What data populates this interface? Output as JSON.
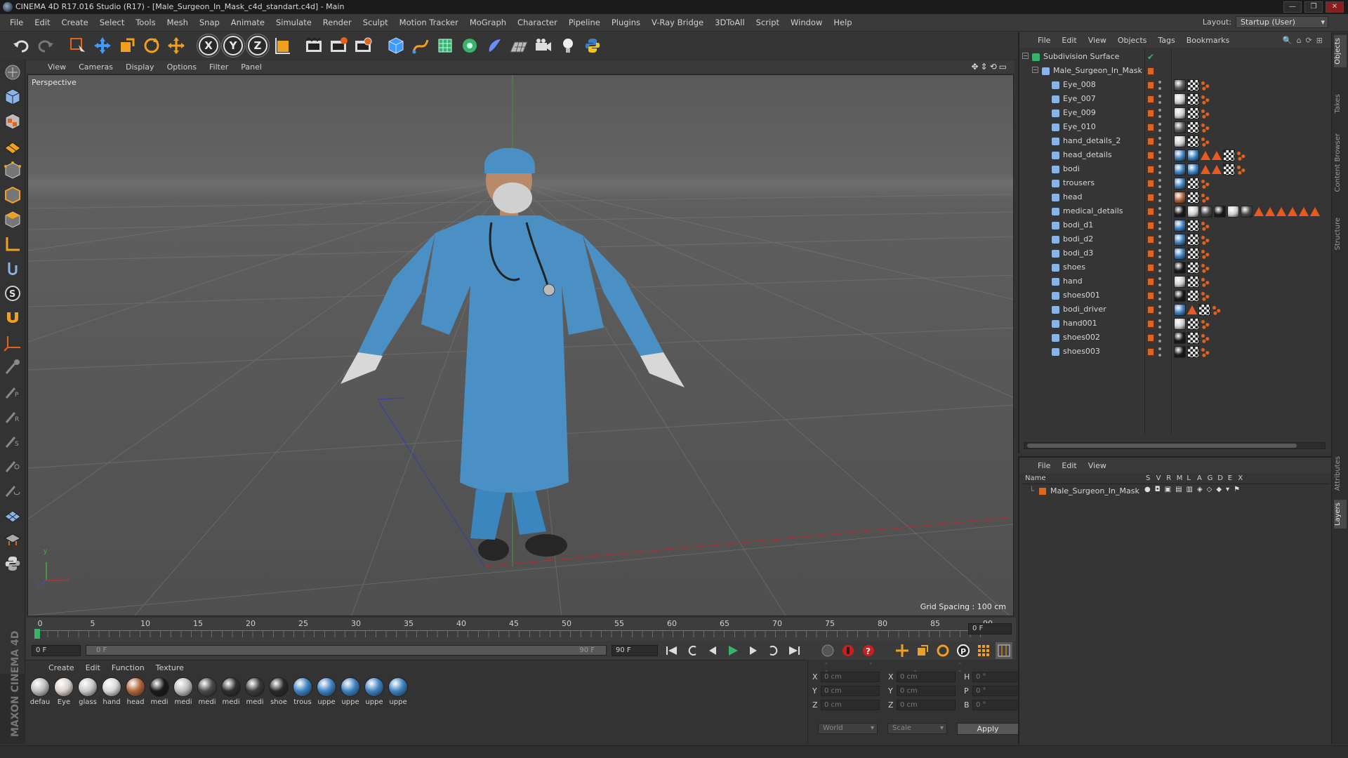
{
  "window": {
    "title": "CINEMA 4D R17.016 Studio (R17) - [Male_Surgeon_In_Mask_c4d_standart.c4d] - Main",
    "controls": [
      "—",
      "❐",
      "✕"
    ]
  },
  "menubar": {
    "items": [
      "File",
      "Edit",
      "Create",
      "Select",
      "Tools",
      "Mesh",
      "Snap",
      "Animate",
      "Simulate",
      "Render",
      "Sculpt",
      "Motion Tracker",
      "MoGraph",
      "Character",
      "Pipeline",
      "Plugins",
      "V-Ray Bridge",
      "3DToAll",
      "Script",
      "Window",
      "Help"
    ],
    "layout_label": "Layout:",
    "layout_value": "Startup (User)"
  },
  "toolbar": {
    "axis_x": "X",
    "axis_y": "Y",
    "axis_z": "Z"
  },
  "viewport": {
    "menu": [
      "View",
      "Cameras",
      "Display",
      "Options",
      "Filter",
      "Panel"
    ],
    "nav_icons": "✥⇕⟲▭",
    "label": "Perspective",
    "grid_spacing": "Grid Spacing : 100 cm",
    "axis_y": "y",
    "axis_x": "x",
    "axis_z": "z"
  },
  "timeline": {
    "ticks": [
      "0",
      "5",
      "10",
      "15",
      "20",
      "25",
      "30",
      "35",
      "40",
      "45",
      "50",
      "55",
      "60",
      "65",
      "70",
      "75",
      "80",
      "85",
      "90"
    ],
    "current_frame": "0 F",
    "start_frame": "0 F",
    "range_start": "0 F",
    "range_end": "90 F",
    "end_frame": "90 F"
  },
  "materials": {
    "menu": [
      "Create",
      "Edit",
      "Function",
      "Texture"
    ],
    "items": [
      {
        "name": "defau",
        "color": "#bdbdbd"
      },
      {
        "name": "Eye",
        "color": "#d8d0c8"
      },
      {
        "name": "glass",
        "color": "#c8c8c8"
      },
      {
        "name": "hand",
        "color": "#d6d6d6"
      },
      {
        "name": "head",
        "color": "#b0653a"
      },
      {
        "name": "medi",
        "color": "#1a1a1a"
      },
      {
        "name": "medi",
        "color": "#bcbcbc"
      },
      {
        "name": "medi",
        "color": "#4a4a4a"
      },
      {
        "name": "medi",
        "color": "#2e2e2e"
      },
      {
        "name": "medi",
        "color": "#3a3a3a"
      },
      {
        "name": "shoe",
        "color": "#2a2a2a"
      },
      {
        "name": "trous",
        "color": "#3f82c0"
      },
      {
        "name": "uppe",
        "color": "#3f82c0"
      },
      {
        "name": "uppe",
        "color": "#3f82c0"
      },
      {
        "name": "uppe",
        "color": "#3f82c0"
      },
      {
        "name": "uppe",
        "color": "#3f82c0"
      }
    ],
    "brand": "MAXON CINEMA 4D"
  },
  "coords": {
    "header": [
      "--",
      "--",
      "--"
    ],
    "rows": [
      {
        "l1": "X",
        "v1": "0 cm",
        "l2": "X",
        "v2": "0 cm",
        "l3": "H",
        "v3": "0 °"
      },
      {
        "l1": "Y",
        "v1": "0 cm",
        "l2": "Y",
        "v2": "0 cm",
        "l3": "P",
        "v3": "0 °"
      },
      {
        "l1": "Z",
        "v1": "0 cm",
        "l2": "Z",
        "v2": "0 cm",
        "l3": "B",
        "v3": "0 °"
      }
    ],
    "space": "World",
    "mode": "Scale",
    "apply": "Apply"
  },
  "objects": {
    "menu": [
      "File",
      "Edit",
      "View",
      "Objects",
      "Tags",
      "Bookmarks"
    ],
    "tool_icons": "🔍⌂⟳⊞",
    "root": "Subdivision Surface",
    "group": "Male_Surgeon_In_Mask",
    "children": [
      {
        "name": "Eye_008",
        "tags": [
          "eye",
          "check",
          "uvw"
        ]
      },
      {
        "name": "Eye_007",
        "tags": [
          "glass",
          "check",
          "uvw"
        ]
      },
      {
        "name": "Eye_009",
        "tags": [
          "glass",
          "check",
          "uvw"
        ]
      },
      {
        "name": "Eye_010",
        "tags": [
          "eye",
          "check",
          "uvw"
        ]
      },
      {
        "name": "hand_details_2",
        "tags": [
          "grey",
          "check",
          "uvw"
        ]
      },
      {
        "name": "head_details",
        "tags": [
          "blue",
          "blue",
          "tri",
          "tri",
          "check",
          "uvw"
        ]
      },
      {
        "name": "bodi",
        "tags": [
          "blue",
          "blue",
          "tri",
          "tri",
          "check",
          "uvw"
        ]
      },
      {
        "name": "trousers",
        "tags": [
          "blue",
          "check",
          "uvw"
        ]
      },
      {
        "name": "head",
        "tags": [
          "skin",
          "check",
          "uvw"
        ]
      },
      {
        "name": "medical_details",
        "tags": [
          "black",
          "grey",
          "dark",
          "black",
          "grey",
          "dark",
          "tri",
          "tri",
          "tri",
          "tri",
          "tri",
          "tri"
        ]
      },
      {
        "name": "bodi_d1",
        "tags": [
          "blue",
          "check",
          "uvw"
        ]
      },
      {
        "name": "bodi_d2",
        "tags": [
          "blue",
          "check",
          "uvw"
        ]
      },
      {
        "name": "bodi_d3",
        "tags": [
          "blue",
          "check",
          "uvw"
        ]
      },
      {
        "name": "shoes",
        "tags": [
          "black",
          "check",
          "uvw"
        ]
      },
      {
        "name": "hand",
        "tags": [
          "grey",
          "check",
          "uvw"
        ]
      },
      {
        "name": "shoes001",
        "tags": [
          "black",
          "check",
          "uvw"
        ]
      },
      {
        "name": "bodi_driver",
        "tags": [
          "blue",
          "tri",
          "check",
          "uvw"
        ]
      },
      {
        "name": "hand001",
        "tags": [
          "grey",
          "check",
          "uvw"
        ]
      },
      {
        "name": "shoes002",
        "tags": [
          "black",
          "check",
          "uvw"
        ]
      },
      {
        "name": "shoes003",
        "tags": [
          "black",
          "check",
          "uvw"
        ]
      }
    ]
  },
  "layers": {
    "menu": [
      "File",
      "Edit",
      "View"
    ],
    "columns": [
      "Name",
      "S",
      "V",
      "R",
      "M",
      "L",
      "A",
      "G",
      "D",
      "E",
      "X"
    ],
    "rows": [
      {
        "name": "Male_Surgeon_In_Mask",
        "color": "#e0641e"
      }
    ]
  },
  "sidetabs": [
    {
      "label": "Objects",
      "active": true
    },
    {
      "label": "Takes",
      "active": false
    },
    {
      "label": "Content Browser",
      "active": false
    },
    {
      "label": "Structure",
      "active": false
    },
    {
      "label": "Attributes",
      "active": false
    },
    {
      "label": "Layers",
      "active": true
    }
  ],
  "colors": {
    "accent_orange": "#e0641e",
    "scrubs_blue": "#4a90c4",
    "layer_orange": "#e0641e"
  }
}
